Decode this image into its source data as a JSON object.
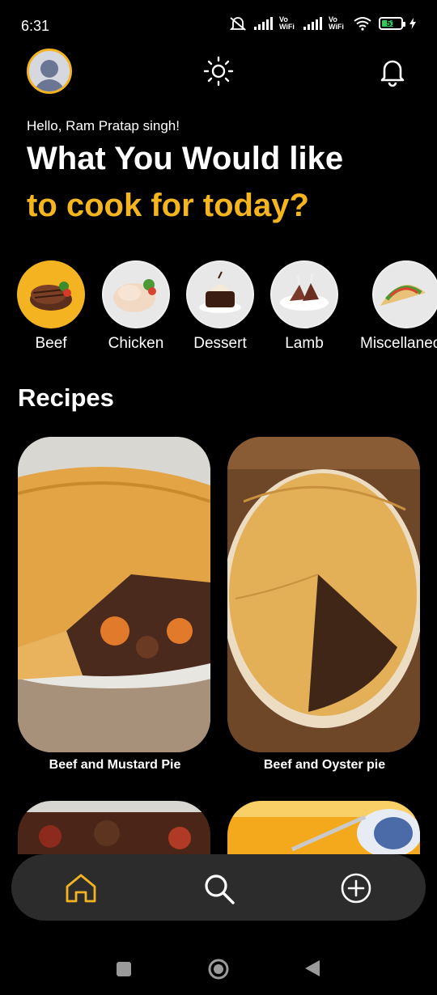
{
  "status_bar": {
    "time": "6:31",
    "battery": "51",
    "vo_wifi_1": "Vo WiFi",
    "vo_wifi_2": "Vo WiFi"
  },
  "header": {
    "avatar_icon": "user-avatar-icon",
    "theme_icon": "sun-icon",
    "notification_icon": "bell-icon"
  },
  "greeting": "Hello, Ram Pratap singh!",
  "headline": {
    "line1": "What You Would like",
    "line2": "to cook for today?"
  },
  "categories": [
    {
      "label": "Beef",
      "active": true
    },
    {
      "label": "Chicken",
      "active": false
    },
    {
      "label": "Dessert",
      "active": false
    },
    {
      "label": "Lamb",
      "active": false
    },
    {
      "label": "Miscellaneous",
      "active": false
    }
  ],
  "recipes_title": "Recipes",
  "recipes": [
    {
      "title": "Beef and Mustard Pie"
    },
    {
      "title": "Beef and Oyster pie"
    },
    {
      "title": ""
    },
    {
      "title": ""
    }
  ],
  "bottom_nav": {
    "items": [
      "home-icon",
      "search-icon",
      "add-circle-icon"
    ],
    "active": "home-icon"
  },
  "colors": {
    "accent": "#f4b321",
    "background": "#000000",
    "nav_bg": "#2c2c2c"
  }
}
